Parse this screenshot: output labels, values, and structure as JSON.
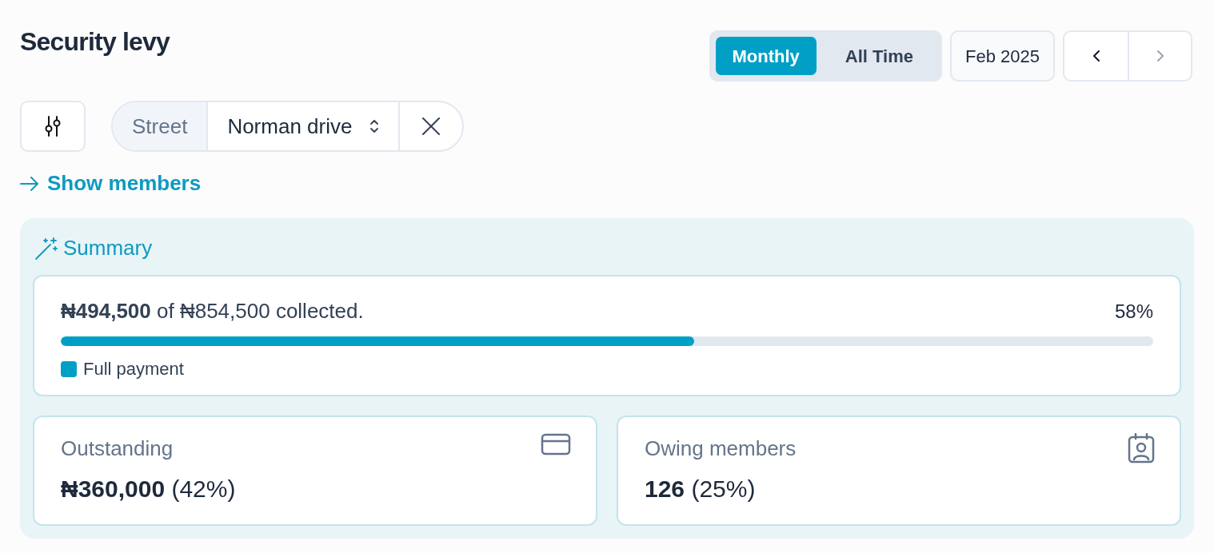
{
  "title": "Security levy",
  "period_tabs": [
    {
      "label": "Monthly",
      "selected": true
    },
    {
      "label": "All Time",
      "selected": false
    }
  ],
  "period": "Feb 2025",
  "nav": [
    {
      "kind": "prev",
      "disabled": false
    },
    {
      "kind": "next",
      "disabled": true
    }
  ],
  "filter": {
    "label": "Street",
    "value": "Norman drive"
  },
  "show_members": "Show members",
  "summary": {
    "title": "Summary",
    "collected": "**₦494,500** of ₦854,500 collected.",
    "percent": "58%",
    "level": 0.58,
    "legend": [
      {
        "label": "Full payment",
        "color": "#00a0c6"
      }
    ],
    "stats": [
      {
        "kind": "card",
        "label": "Outstanding",
        "value": "**₦360,000** (42%)"
      },
      {
        "kind": "member",
        "label": "Owing members",
        "value": "**126** (25%)"
      }
    ]
  }
}
